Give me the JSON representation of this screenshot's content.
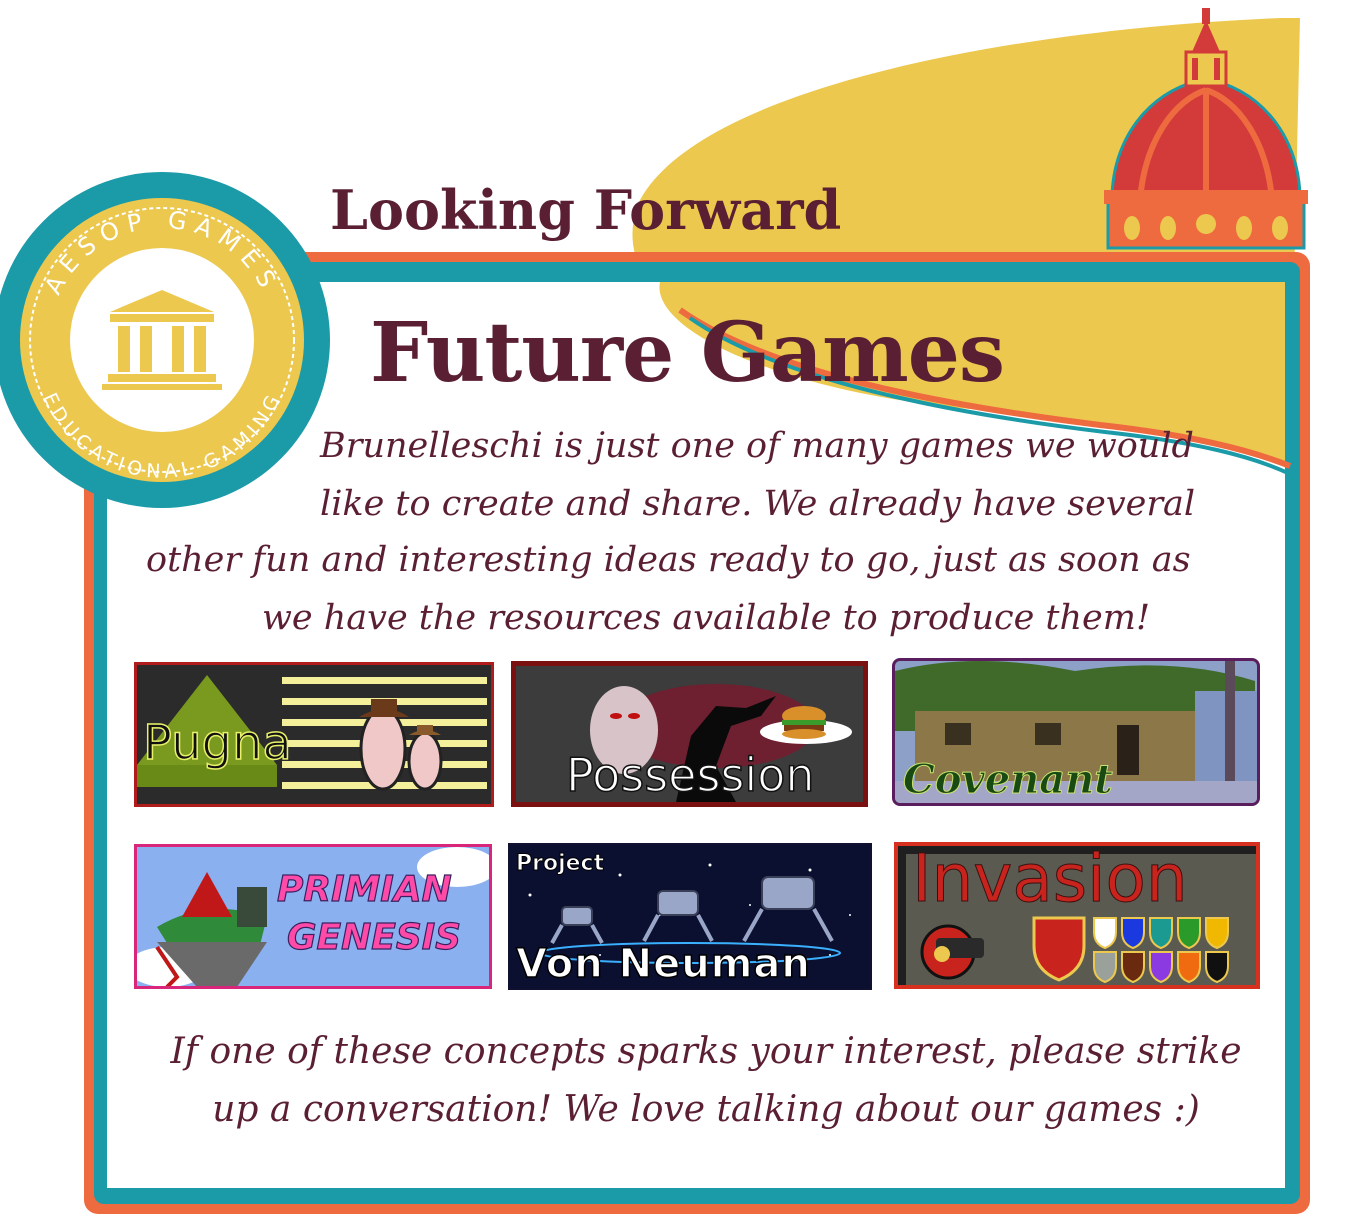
{
  "badge": {
    "top_text": "AESOP GAMES",
    "bottom_text": "EDUCATIONAL GAMING"
  },
  "section_title": "Looking Forward",
  "page_title": "Future Games",
  "intro": {
    "line1": "Brunelleschi is just one of many games we would",
    "line2": "like to create and share.  We already have several",
    "line3": "other fun and interesting ideas ready to go, just as soon as",
    "line4": "we have the resources available to produce them!"
  },
  "games": [
    {
      "name": "Pugna"
    },
    {
      "name": "Possession"
    },
    {
      "name": "Covenant"
    },
    {
      "name_line1": "PRIMIAN",
      "name_line2": "GENESIS"
    },
    {
      "prefix": "Project",
      "name": "Von Neuman"
    },
    {
      "name": "Invasion"
    }
  ],
  "outro": {
    "line1": "If one of these concepts sparks your interest, please strike",
    "line2": "up a conversation!  We love talking about our games :)"
  },
  "colors": {
    "frame_orange": "#ee6a3f",
    "frame_teal": "#1b9aa8",
    "gold": "#ecc84f",
    "dome_red": "#d33a3a",
    "text_maroon": "#5a1f33"
  }
}
